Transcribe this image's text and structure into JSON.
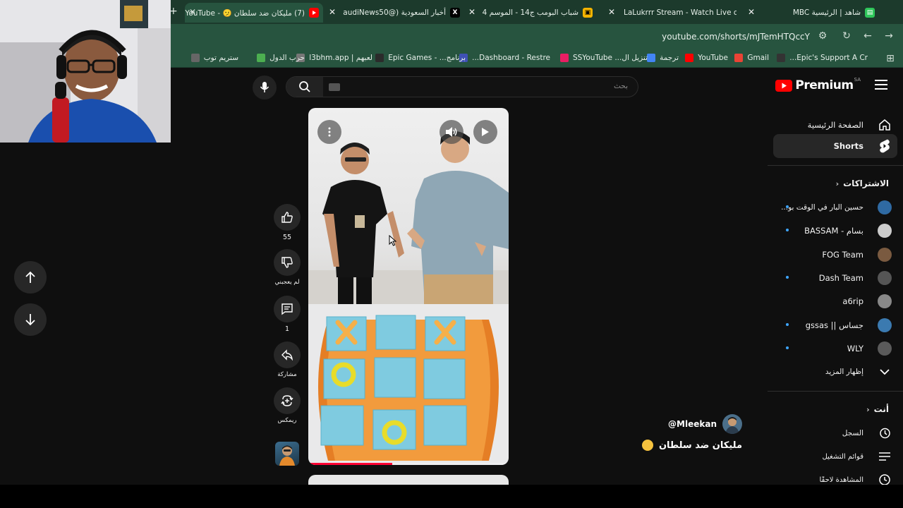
{
  "browser": {
    "tabs": [
      {
        "title": "(7) مليكان ضد سلطان 🫤 - YouTube",
        "active": true,
        "fav_color": "#ff0000",
        "icon": "youtube-icon"
      },
      {
        "title": "أخبار السعودية (@SaudiNews50)",
        "fav_color": "#000000",
        "icon": "x-icon"
      },
      {
        "title": "شباب البومب ج14 - الموسم 14 -",
        "fav_color": "#f5b400",
        "icon": "film-icon"
      },
      {
        "title": "LaLukrrr Stream - Watch Live on",
        "fav_color": "#53fc18",
        "icon": "kick-icon"
      },
      {
        "title": "شاهد | الرئيسية MBC",
        "fav_color": "#2ec65a",
        "icon": "shahid-icon"
      }
    ],
    "url": "youtube.com/shorts/mJTemHTQccY",
    "bookmarks": [
      {
        "label": "Epic's Support A Cr...",
        "color": "#333333"
      },
      {
        "label": "Gmail",
        "color": "#ea4335"
      },
      {
        "label": "YouTube",
        "color": "#ff0000"
      },
      {
        "label": "ترجمة",
        "color": "#4285f4"
      },
      {
        "label": "تنزيل ال... SSYouTube",
        "color": "#e91e63"
      },
      {
        "label": "Dashboard - Restre...",
        "color": "#3f51b5"
      },
      {
        "label": "برنامج... - Epic Games",
        "color": "#2b2b2b"
      },
      {
        "label": "لعبهم | l3bhm.app",
        "color": "#777777"
      },
      {
        "label": "حرب الدول",
        "color": "#4caf50"
      },
      {
        "label": "ستريم توب",
        "color": "#666666"
      }
    ]
  },
  "masthead": {
    "search_placeholder": "بحث",
    "brand": "Premium",
    "brand_region": "SA"
  },
  "sidebar": {
    "home": "الصفحة الرئيسية",
    "shorts": "Shorts",
    "subscriptions_header": "الاشتراكات",
    "subscriptions": [
      {
        "name": "حسين البار في الوقت بو...",
        "dot": true,
        "color": "#2f6aa3"
      },
      {
        "name": "بسام - BASSAM",
        "dot": true,
        "color": "#cccccc"
      },
      {
        "name": "FOG Team",
        "dot": false,
        "color": "#7a5a40"
      },
      {
        "name": "Dash Team",
        "dot": true,
        "color": "#555555"
      },
      {
        "name": "a6rip",
        "dot": false,
        "color": "#888888"
      },
      {
        "name": "جساس || gssas",
        "dot": true,
        "color": "#3b7ab0"
      },
      {
        "name": "WLY",
        "dot": true,
        "color": "#5a5a5a"
      }
    ],
    "show_more": "إظهار المزيد",
    "you_header": "أنت",
    "history": "السجل",
    "playlists": "قوائم التشغيل",
    "watch_later": "المشاهدة لاحقًا"
  },
  "short": {
    "likes": "55",
    "dislike_label": "لم يعجبني",
    "comments": "1",
    "share_label": "مشاركة",
    "remix_label": "ريمكس",
    "channel_handle": "@Mleekan",
    "title": "مليكان ضد سلطان",
    "progress": 0.42
  },
  "colors": {
    "accent": "#ff0000",
    "chrome_dark": "#1c3a2c",
    "chrome": "#27543f"
  }
}
